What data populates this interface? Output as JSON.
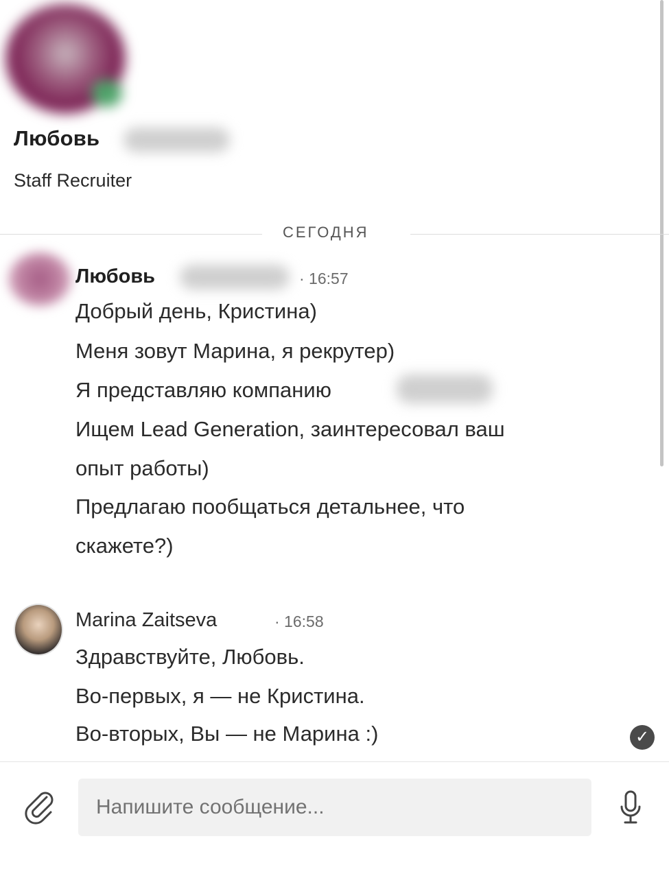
{
  "header": {
    "name": "Любовь",
    "title": "Staff Recruiter"
  },
  "divider": {
    "label": "СЕГОДНЯ"
  },
  "messages": [
    {
      "author": "Любовь",
      "time": "· 16:57",
      "lines": [
        "Добрый день, Кристина)",
        "Меня зовут Марина, я рекрутер)",
        "Я представляю компанию",
        "Ищем Lead Generation, заинтересовал ваш",
        "опыт работы)",
        "Предлагаю пообщаться детальнее, что",
        "скажете?)"
      ]
    },
    {
      "author": "Marina Zaitseva",
      "time": "· 16:58",
      "lines": [
        "Здравствуйте, Любовь.",
        "Во-первых, я — не Кристина.",
        "Во-вторых, Вы — не Марина :)"
      ],
      "status_icon": "check-icon"
    }
  ],
  "composer": {
    "placeholder": "Напишите сообщение...",
    "attach_icon": "paperclip-icon",
    "mic_icon": "microphone-icon"
  },
  "colors": {
    "text": "#1f1f1f",
    "muted": "#6b6b6b",
    "input_bg": "#f1f1f1"
  }
}
